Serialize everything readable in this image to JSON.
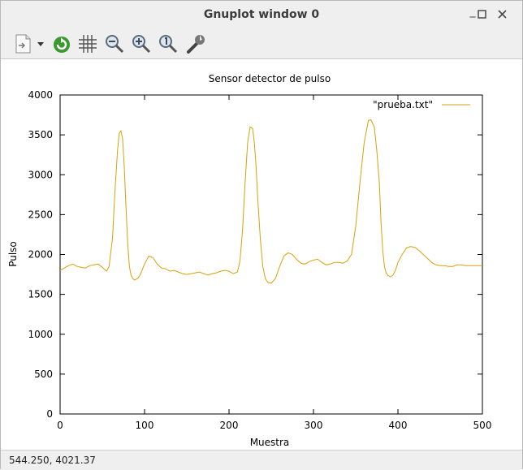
{
  "window": {
    "title": "Gnuplot window 0",
    "minimize": "_",
    "maximize": "□",
    "close": "✕"
  },
  "toolbar": {
    "items": [
      {
        "name": "export-button",
        "icon": "document-export-icon"
      },
      {
        "name": "replot-button",
        "icon": "refresh-icon"
      },
      {
        "name": "grid-button",
        "icon": "grid-icon"
      },
      {
        "name": "zoom-out-button",
        "icon": "zoom-out-icon"
      },
      {
        "name": "zoom-in-button",
        "icon": "zoom-in-icon"
      },
      {
        "name": "zoom-reset-button",
        "icon": "zoom-reset-icon"
      },
      {
        "name": "settings-button",
        "icon": "wrench-icon"
      }
    ]
  },
  "status": {
    "text": "544.250,  4021.37"
  },
  "colors": {
    "series": "#d9a10a"
  },
  "chart_data": {
    "type": "line",
    "title": "Sensor detector de pulso",
    "xlabel": "Muestra",
    "ylabel": "Pulso",
    "xlim": [
      0,
      500
    ],
    "ylim": [
      0,
      4000
    ],
    "xticks": [
      0,
      100,
      200,
      300,
      400,
      500
    ],
    "yticks": [
      0,
      500,
      1000,
      1500,
      2000,
      2500,
      3000,
      3500,
      4000
    ],
    "grid": false,
    "legend": "top-right",
    "series": [
      {
        "name": "\"prueba.txt\"",
        "x": [
          0,
          5,
          10,
          15,
          20,
          25,
          30,
          35,
          40,
          45,
          50,
          55,
          58,
          62,
          65,
          68,
          70,
          72,
          74,
          76,
          78,
          80,
          82,
          84,
          86,
          88,
          90,
          92,
          95,
          100,
          105,
          110,
          115,
          120,
          125,
          130,
          135,
          140,
          145,
          150,
          155,
          160,
          165,
          170,
          175,
          180,
          185,
          190,
          195,
          200,
          205,
          210,
          213,
          216,
          219,
          222,
          225,
          228,
          230,
          232,
          234,
          237,
          240,
          243,
          246,
          250,
          255,
          260,
          265,
          270,
          275,
          280,
          285,
          290,
          295,
          300,
          305,
          310,
          315,
          320,
          325,
          330,
          335,
          340,
          345,
          350,
          355,
          360,
          365,
          368,
          372,
          375,
          378,
          380,
          382,
          384,
          386,
          388,
          391,
          394,
          397,
          400,
          405,
          410,
          415,
          420,
          425,
          430,
          435,
          440,
          445,
          450,
          455,
          460,
          465,
          470,
          475,
          480,
          485,
          490,
          495,
          500
        ],
        "y": [
          1800,
          1830,
          1860,
          1880,
          1850,
          1840,
          1830,
          1860,
          1870,
          1880,
          1840,
          1790,
          1850,
          2200,
          2800,
          3300,
          3520,
          3550,
          3450,
          3100,
          2600,
          2150,
          1850,
          1740,
          1700,
          1680,
          1690,
          1700,
          1750,
          1880,
          1980,
          1960,
          1880,
          1830,
          1820,
          1790,
          1800,
          1780,
          1760,
          1750,
          1760,
          1770,
          1780,
          1760,
          1740,
          1760,
          1770,
          1790,
          1800,
          1790,
          1760,
          1780,
          1920,
          2300,
          2900,
          3400,
          3600,
          3580,
          3400,
          3100,
          2700,
          2200,
          1850,
          1700,
          1650,
          1640,
          1700,
          1850,
          1980,
          2020,
          2000,
          1940,
          1890,
          1880,
          1910,
          1930,
          1940,
          1900,
          1870,
          1880,
          1900,
          1900,
          1890,
          1920,
          2000,
          2350,
          2900,
          3400,
          3680,
          3690,
          3600,
          3300,
          2900,
          2400,
          2050,
          1850,
          1770,
          1740,
          1720,
          1740,
          1800,
          1900,
          2000,
          2080,
          2100,
          2090,
          2050,
          2000,
          1950,
          1900,
          1870,
          1860,
          1860,
          1850,
          1850,
          1870,
          1870,
          1860,
          1860,
          1860,
          1860,
          1860
        ]
      }
    ]
  }
}
